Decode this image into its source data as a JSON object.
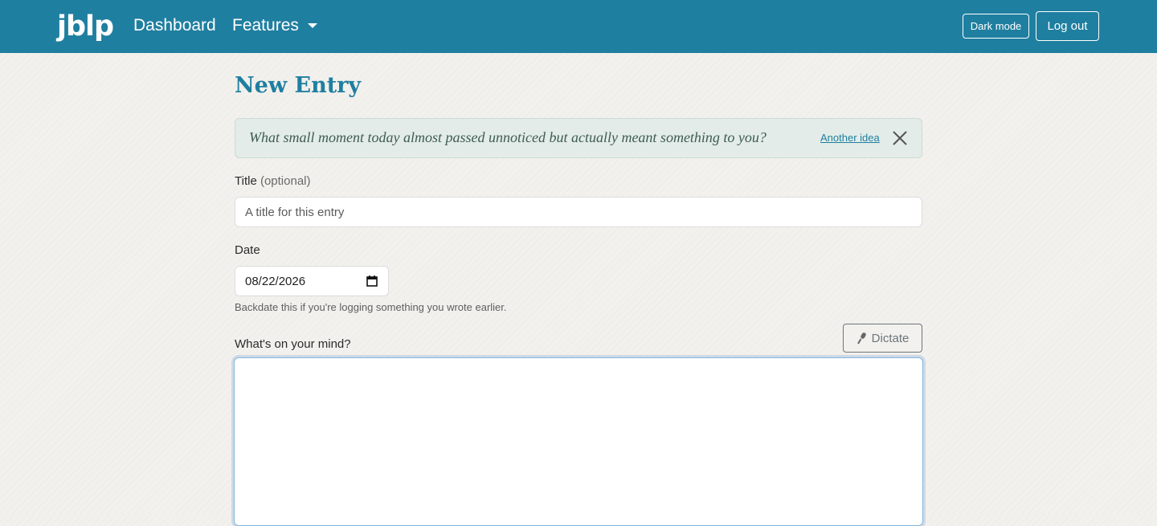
{
  "navbar": {
    "brand": "jblp",
    "links": {
      "dashboard": "Dashboard",
      "features": "Features"
    },
    "dark_mode_label": "Dark mode",
    "logout_label": "Log out",
    "background_color": "#1f7fa0"
  },
  "main": {
    "title": "New Entry",
    "prompt": {
      "text": "What small moment today almost passed unnoticed but actually meant something to you?",
      "another_idea_label": "Another idea",
      "close_icon": "close-icon"
    },
    "title_field": {
      "label": "Title",
      "label_suffix": "(optional)",
      "placeholder": "A title for this entry",
      "value": ""
    },
    "date_field": {
      "label": "Date",
      "value": "08/22/2026",
      "help": "Backdate this if you're logging something you wrote earlier.",
      "icon": "calendar-icon"
    },
    "body_field": {
      "label": "What's on your mind?",
      "value": "",
      "dictate_label": "Dictate",
      "dictate_icon": "microphone-icon"
    }
  },
  "colors": {
    "accent": "#1f7fa0",
    "page_background": "#f3f1ed",
    "prompt_background": "#e3ece8"
  }
}
